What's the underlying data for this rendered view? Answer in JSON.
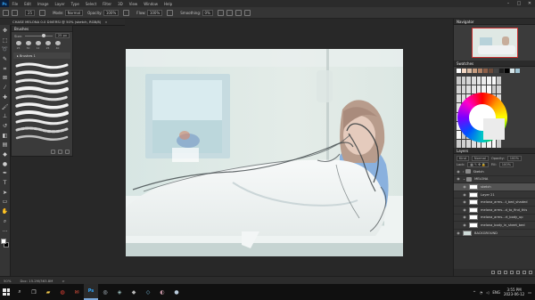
{
  "menubar": {
    "app_badge": "Ps",
    "items": [
      "File",
      "Edit",
      "Image",
      "Layer",
      "Type",
      "Select",
      "Filter",
      "3D",
      "View",
      "Window",
      "Help"
    ]
  },
  "options_bar": {
    "size_value": "25",
    "mode_label": "Mode:",
    "mode_value": "Normal",
    "opacity_label": "Opacity:",
    "opacity_value": "100%",
    "flow_label": "Flow:",
    "flow_value": "100%",
    "smoothing_label": "Smoothing:",
    "smoothing_value": "0%"
  },
  "document_tab": {
    "title": "CHASE MELONA 0.0 DIVERSI @ 50% (sketch, RGB/8)",
    "close_glyph": "×"
  },
  "brush_panel": {
    "title": "Brushes",
    "size_label": "Size:",
    "size_value": "25 px",
    "presets": [
      "25",
      "30",
      "12",
      "25",
      "40"
    ],
    "folder_label": "Brushes 1"
  },
  "navigator": {
    "title": "Navigator"
  },
  "swatches": {
    "title": "Swatches",
    "recent_colors": [
      "#ffffff",
      "#f2d7c4",
      "#d8b9a2",
      "#c79d80",
      "#b08064",
      "#8e5f48",
      "#6c4b3a",
      "#444444",
      "#1f1f1f",
      "#000000",
      "#d7e6ea",
      "#9fc4d4"
    ]
  },
  "layers": {
    "title": "Layers",
    "kind_label": "Kind",
    "blend_mode": "Normal",
    "opacity_label": "Opacity:",
    "opacity_value": "100%",
    "lock_label": "Lock:",
    "fill_label": "Fill:",
    "fill_value": "100%",
    "rows": [
      {
        "name": "Sketch",
        "type": "folder",
        "indent": 0
      },
      {
        "name": "MELONA",
        "type": "folder",
        "indent": 0
      },
      {
        "name": "sketch",
        "type": "layer",
        "indent": 1,
        "selected": true
      },
      {
        "name": "Layer 21",
        "type": "layer",
        "indent": 1
      },
      {
        "name": "melona_arms...t_bed_shaded",
        "type": "layer",
        "indent": 1
      },
      {
        "name": "melona_arms...d_to_find_this",
        "type": "layer",
        "indent": 1
      },
      {
        "name": "melona_arms...rt_body_up",
        "type": "layer",
        "indent": 1
      },
      {
        "name": "melona_body_in_sheet_bed",
        "type": "layer",
        "indent": 1
      },
      {
        "name": "BACKGROUND",
        "type": "layer",
        "indent": 0
      }
    ]
  },
  "status_bar": {
    "zoom": "50%",
    "doc_size": "Doc: 15.2M/363.8M",
    "arrow": ">"
  },
  "taskbar": {
    "apps": [
      "search-app",
      "task-view-app",
      "explorer-app",
      "chrome-app",
      "mail-app",
      "photoshop-app",
      "steam-app",
      "app-2",
      "app-3",
      "app-4",
      "app-5",
      "app-6"
    ],
    "active_app": "photoshop-app",
    "language": "ENG",
    "time": "3:55 PM",
    "date": "2023-06-12"
  },
  "colors": {
    "foreground": "#ffffff",
    "background": "#000000",
    "accent_photoshop": "#31a8ff"
  }
}
